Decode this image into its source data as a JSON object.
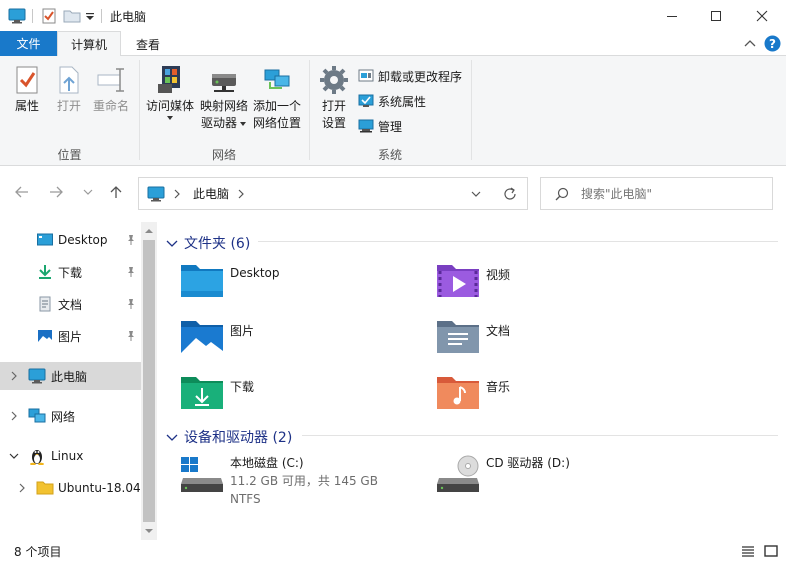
{
  "window": {
    "title": "此电脑"
  },
  "ribbon_tabs": {
    "file": "文件",
    "computer": "计算机",
    "view": "查看"
  },
  "ribbon": {
    "location": {
      "label": "位置",
      "properties": "属性",
      "open": "打开",
      "rename": "重命名"
    },
    "network": {
      "label": "网络",
      "access_media": "访问媒体",
      "map_drive_line1": "映射网络",
      "map_drive_line2": "驱动器",
      "add_location_line1": "添加一个",
      "add_location_line2": "网络位置"
    },
    "system": {
      "label": "系统",
      "open_settings_line1": "打开",
      "open_settings_line2": "设置",
      "uninstall": "卸载或更改程序",
      "sys_properties": "系统属性",
      "manage": "管理"
    }
  },
  "address": {
    "current": "此电脑",
    "search_placeholder": "搜索\"此电脑\""
  },
  "sidebar": {
    "items": [
      {
        "label": "Desktop",
        "pinned": true
      },
      {
        "label": "下载",
        "pinned": true
      },
      {
        "label": "文档",
        "pinned": true
      },
      {
        "label": "图片",
        "pinned": true
      },
      {
        "label": "此电脑",
        "selected": true
      },
      {
        "label": "网络"
      },
      {
        "label": "Linux"
      },
      {
        "label": "Ubuntu-18.04"
      }
    ]
  },
  "content": {
    "folders_header": "文件夹 (6)",
    "folders": [
      {
        "label": "Desktop"
      },
      {
        "label": "视频"
      },
      {
        "label": "图片"
      },
      {
        "label": "文档"
      },
      {
        "label": "下载"
      },
      {
        "label": "音乐"
      }
    ],
    "drives_header": "设备和驱动器 (2)",
    "drives": [
      {
        "label": "本地磁盘 (C:)",
        "space": "11.2 GB 可用，共 145 GB",
        "fs": "NTFS",
        "used_fraction": 0.92
      },
      {
        "label": "CD 驱动器 (D:)"
      }
    ]
  },
  "status": {
    "count": "8 个项目"
  },
  "colors": {
    "accent": "#1979ca",
    "section_header": "#1e3287",
    "selected_bg": "#d9d9d9",
    "drive_bar": "#26a0da"
  }
}
